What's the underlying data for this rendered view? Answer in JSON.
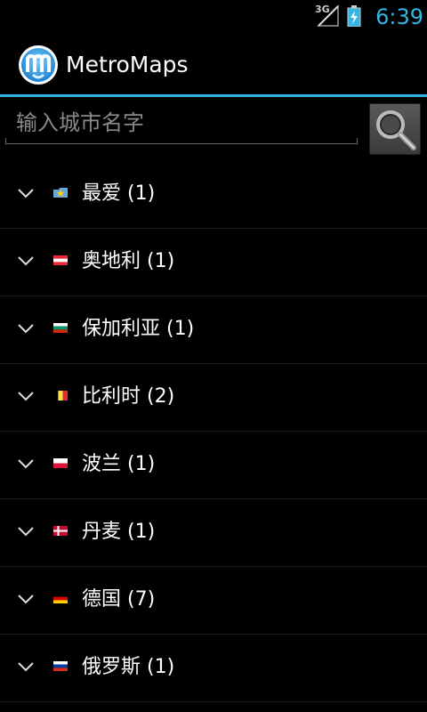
{
  "status_bar": {
    "network_type": "3G",
    "time": "6:39",
    "accent_color": "#33b5e5"
  },
  "action_bar": {
    "app_title": "MetroMaps",
    "logo_icon": "metromaps-logo-icon"
  },
  "search": {
    "placeholder": "输入城市名字",
    "value": "",
    "button_icon": "magnifier-icon"
  },
  "countries": [
    {
      "label": "最爱 (1)",
      "flag": "favorites-star-icon"
    },
    {
      "label": "奥地利 (1)",
      "flag": "flag-austria-icon"
    },
    {
      "label": "保加利亚 (1)",
      "flag": "flag-bulgaria-icon"
    },
    {
      "label": "比利时 (2)",
      "flag": "flag-belgium-icon"
    },
    {
      "label": "波兰 (1)",
      "flag": "flag-poland-icon"
    },
    {
      "label": "丹麦 (1)",
      "flag": "flag-denmark-icon"
    },
    {
      "label": "德国 (7)",
      "flag": "flag-germany-icon"
    },
    {
      "label": "俄罗斯 (1)",
      "flag": "flag-russia-icon"
    }
  ]
}
